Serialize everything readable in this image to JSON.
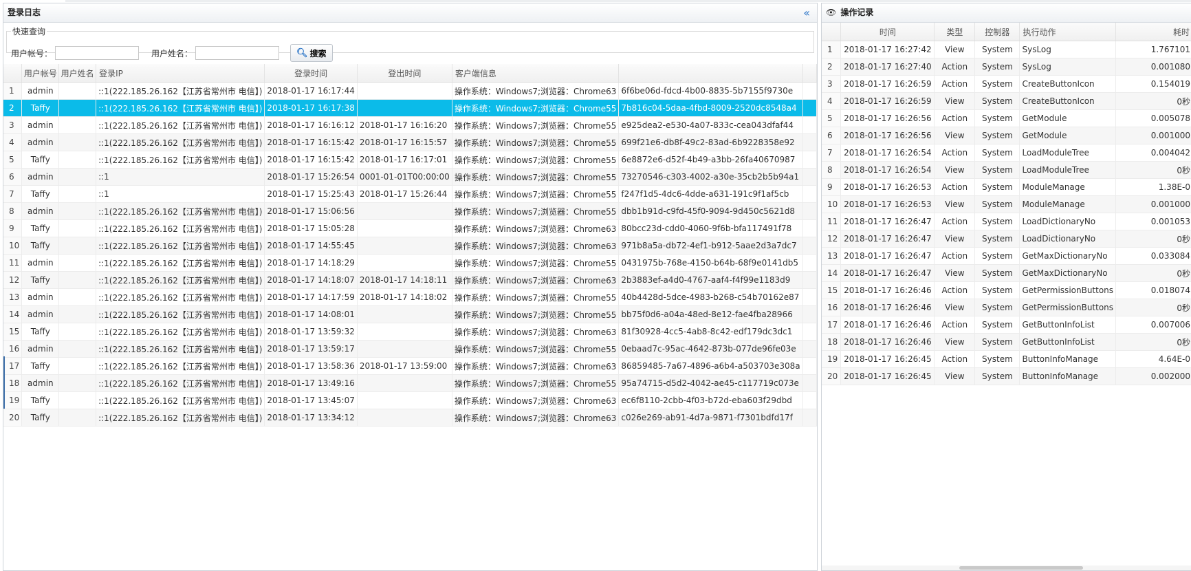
{
  "login_log": {
    "title": "登录日志",
    "collapse_icon": "«",
    "quick_search": {
      "legend": "快速查询",
      "account_label": "用户帐号：",
      "account_value": "",
      "name_label": "用户姓名：",
      "name_value": "",
      "search_button": "搜索"
    },
    "columns": [
      "用户帐号",
      "用户姓名",
      "登录IP",
      "登录时间",
      "登出时间",
      "客户端信息",
      ""
    ],
    "rows": [
      {
        "no": "1",
        "account": "admin",
        "name": "",
        "ip": "::1(222.185.26.162【江苏省常州市 电信】)",
        "login": "2018-01-17 16:17:44",
        "logout": "",
        "client": "操作系统：Windows7;浏览器：Chrome63",
        "session": "6f6be06d-fdcd-4b00-8835-5b7155f9730e"
      },
      {
        "no": "2",
        "account": "Taffy",
        "name": "",
        "ip": "::1(222.185.26.162【江苏省常州市 电信】)",
        "login": "2018-01-17 16:17:38",
        "logout": "",
        "client": "操作系统：Windows7;浏览器：Chrome55",
        "session": "7b816c04-5daa-4fbd-8009-2520dc8548a4"
      },
      {
        "no": "3",
        "account": "admin",
        "name": "",
        "ip": "::1(222.185.26.162【江苏省常州市 电信】)",
        "login": "2018-01-17 16:16:12",
        "logout": "2018-01-17 16:16:20",
        "client": "操作系统：Windows7;浏览器：Chrome55",
        "session": "e925dea2-e530-4a07-833c-cea043dfaf44"
      },
      {
        "no": "4",
        "account": "admin",
        "name": "",
        "ip": "::1(222.185.26.162【江苏省常州市 电信】)",
        "login": "2018-01-17 16:15:42",
        "logout": "2018-01-17 16:15:57",
        "client": "操作系统：Windows7;浏览器：Chrome55",
        "session": "699f21e6-db8f-49c2-83ad-6b9228358e92"
      },
      {
        "no": "5",
        "account": "Taffy",
        "name": "",
        "ip": "::1(222.185.26.162【江苏省常州市 电信】)",
        "login": "2018-01-17 16:15:42",
        "logout": "2018-01-17 16:17:01",
        "client": "操作系统：Windows7;浏览器：Chrome55",
        "session": "6e8872e6-d52f-4b49-a3bb-26fa40670987"
      },
      {
        "no": "6",
        "account": "admin",
        "name": "",
        "ip": "::1",
        "login": "2018-01-17 15:26:54",
        "logout": "0001-01-01T00:00:00",
        "client": "操作系统：Windows7;浏览器：Chrome55",
        "session": "73270546-c303-4002-a30e-35cb2b5b94a1"
      },
      {
        "no": "7",
        "account": "Taffy",
        "name": "",
        "ip": "::1",
        "login": "2018-01-17 15:25:43",
        "logout": "2018-01-17 15:26:44",
        "client": "操作系统：Windows7;浏览器：Chrome55",
        "session": "f247f1d5-4dc6-4dde-a631-191c9f1af5cb"
      },
      {
        "no": "8",
        "account": "admin",
        "name": "",
        "ip": "::1(222.185.26.162【江苏省常州市 电信】)",
        "login": "2018-01-17 15:06:56",
        "logout": "",
        "client": "操作系统：Windows7;浏览器：Chrome55",
        "session": "dbb1b91d-c9fd-45f0-9094-9d450c5621d8"
      },
      {
        "no": "9",
        "account": "Taffy",
        "name": "",
        "ip": "::1(222.185.26.162【江苏省常州市 电信】)",
        "login": "2018-01-17 15:05:28",
        "logout": "",
        "client": "操作系统：Windows7;浏览器：Chrome63",
        "session": "80bcc23d-cdd0-4060-9f6b-bfa117491f78"
      },
      {
        "no": "10",
        "account": "Taffy",
        "name": "",
        "ip": "::1(222.185.26.162【江苏省常州市 电信】)",
        "login": "2018-01-17 14:55:45",
        "logout": "",
        "client": "操作系统：Windows7;浏览器：Chrome63",
        "session": "971b8a5a-db72-4ef1-b912-5aae2d3a7dc7"
      },
      {
        "no": "11",
        "account": "admin",
        "name": "",
        "ip": "::1(222.185.26.162【江苏省常州市 电信】)",
        "login": "2018-01-17 14:18:29",
        "logout": "",
        "client": "操作系统：Windows7;浏览器：Chrome55",
        "session": "0431975b-768e-4150-b64b-68f9e0141db5"
      },
      {
        "no": "12",
        "account": "Taffy",
        "name": "",
        "ip": "::1(222.185.26.162【江苏省常州市 电信】)",
        "login": "2018-01-17 14:18:07",
        "logout": "2018-01-17 14:18:11",
        "client": "操作系统：Windows7;浏览器：Chrome63",
        "session": "2b3883ef-a4d0-4767-aaf4-f4f99e1183d9"
      },
      {
        "no": "13",
        "account": "admin",
        "name": "",
        "ip": "::1(222.185.26.162【江苏省常州市 电信】)",
        "login": "2018-01-17 14:17:59",
        "logout": "2018-01-17 14:18:02",
        "client": "操作系统：Windows7;浏览器：Chrome55",
        "session": "40b4428d-5dce-4983-b268-c54b70162e87"
      },
      {
        "no": "14",
        "account": "admin",
        "name": "",
        "ip": "::1(222.185.26.162【江苏省常州市 电信】)",
        "login": "2018-01-17 14:08:01",
        "logout": "",
        "client": "操作系统：Windows7;浏览器：Chrome55",
        "session": "bb75f0d6-a04a-48ed-8e12-fae4fba28966"
      },
      {
        "no": "15",
        "account": "Taffy",
        "name": "",
        "ip": "::1(222.185.26.162【江苏省常州市 电信】)",
        "login": "2018-01-17 13:59:32",
        "logout": "",
        "client": "操作系统：Windows7;浏览器：Chrome63",
        "session": "81f30928-4cc5-4ab8-8c42-edf179dc3dc1"
      },
      {
        "no": "16",
        "account": "admin",
        "name": "",
        "ip": "::1(222.185.26.162【江苏省常州市 电信】)",
        "login": "2018-01-17 13:59:17",
        "logout": "",
        "client": "操作系统：Windows7;浏览器：Chrome55",
        "session": "0ebaad7c-95ac-4642-873b-077de96fe03e"
      },
      {
        "no": "17",
        "account": "Taffy",
        "name": "",
        "ip": "::1(222.185.26.162【江苏省常州市 电信】)",
        "login": "2018-01-17 13:58:36",
        "logout": "2018-01-17 13:59:00",
        "client": "操作系统：Windows7;浏览器：Chrome63",
        "session": "86859485-7a67-4896-a6b4-a503703e308a"
      },
      {
        "no": "18",
        "account": "admin",
        "name": "",
        "ip": "::1(222.185.26.162【江苏省常州市 电信】)",
        "login": "2018-01-17 13:49:16",
        "logout": "",
        "client": "操作系统：Windows7;浏览器：Chrome55",
        "session": "95a74715-d5d2-4042-ae45-c117719c073e"
      },
      {
        "no": "19",
        "account": "Taffy",
        "name": "",
        "ip": "::1(222.185.26.162【江苏省常州市 电信】)",
        "login": "2018-01-17 13:45:07",
        "logout": "",
        "client": "操作系统：Windows7;浏览器：Chrome63",
        "session": "ec6f8110-2cbb-4f03-b72d-eba603f29dbd"
      },
      {
        "no": "20",
        "account": "Taffy",
        "name": "",
        "ip": "::1(222.185.26.162【江苏省常州市 电信】)",
        "login": "2018-01-17 13:34:12",
        "logout": "",
        "client": "操作系统：Windows7;浏览器：Chrome63",
        "session": "c026e269-ab91-4d7a-9871-f7301bdfd17f"
      }
    ],
    "selected_row": "2"
  },
  "operation_log": {
    "title": "操作记录",
    "icon": "eye-icon",
    "columns": [
      "时间",
      "类型",
      "控制器",
      "执行动作",
      "耗时"
    ],
    "rows": [
      {
        "no": "1",
        "time": "2018-01-17 16:27:42",
        "type": "View",
        "controller": "System",
        "action": "SysLog",
        "cost": "1.767101"
      },
      {
        "no": "2",
        "time": "2018-01-17 16:27:40",
        "type": "Action",
        "controller": "System",
        "action": "SysLog",
        "cost": "0.001080"
      },
      {
        "no": "3",
        "time": "2018-01-17 16:26:59",
        "type": "Action",
        "controller": "System",
        "action": "CreateButtonIcon",
        "cost": "0.154019"
      },
      {
        "no": "4",
        "time": "2018-01-17 16:26:59",
        "type": "View",
        "controller": "System",
        "action": "CreateButtonIcon",
        "cost": "0秒"
      },
      {
        "no": "5",
        "time": "2018-01-17 16:26:56",
        "type": "Action",
        "controller": "System",
        "action": "GetModule",
        "cost": "0.005078"
      },
      {
        "no": "6",
        "time": "2018-01-17 16:26:56",
        "type": "View",
        "controller": "System",
        "action": "GetModule",
        "cost": "0.001000"
      },
      {
        "no": "7",
        "time": "2018-01-17 16:26:54",
        "type": "Action",
        "controller": "System",
        "action": "LoadModuleTree",
        "cost": "0.004042"
      },
      {
        "no": "8",
        "time": "2018-01-17 16:26:54",
        "type": "View",
        "controller": "System",
        "action": "LoadModuleTree",
        "cost": "0秒"
      },
      {
        "no": "9",
        "time": "2018-01-17 16:26:53",
        "type": "Action",
        "controller": "System",
        "action": "ModuleManage",
        "cost": "1.38E-0"
      },
      {
        "no": "10",
        "time": "2018-01-17 16:26:53",
        "type": "View",
        "controller": "System",
        "action": "ModuleManage",
        "cost": "0.001000"
      },
      {
        "no": "11",
        "time": "2018-01-17 16:26:47",
        "type": "Action",
        "controller": "System",
        "action": "LoadDictionaryNo",
        "cost": "0.001053"
      },
      {
        "no": "12",
        "time": "2018-01-17 16:26:47",
        "type": "View",
        "controller": "System",
        "action": "LoadDictionaryNo",
        "cost": "0秒"
      },
      {
        "no": "13",
        "time": "2018-01-17 16:26:47",
        "type": "Action",
        "controller": "System",
        "action": "GetMaxDictionaryNo",
        "cost": "0.033084"
      },
      {
        "no": "14",
        "time": "2018-01-17 16:26:47",
        "type": "View",
        "controller": "System",
        "action": "GetMaxDictionaryNo",
        "cost": "0秒"
      },
      {
        "no": "15",
        "time": "2018-01-17 16:26:46",
        "type": "Action",
        "controller": "System",
        "action": "GetPermissionButtons",
        "cost": "0.018074"
      },
      {
        "no": "16",
        "time": "2018-01-17 16:26:46",
        "type": "View",
        "controller": "System",
        "action": "GetPermissionButtons",
        "cost": "0秒"
      },
      {
        "no": "17",
        "time": "2018-01-17 16:26:46",
        "type": "Action",
        "controller": "System",
        "action": "GetButtonInfoList",
        "cost": "0.007006"
      },
      {
        "no": "18",
        "time": "2018-01-17 16:26:46",
        "type": "View",
        "controller": "System",
        "action": "GetButtonInfoList",
        "cost": "0秒"
      },
      {
        "no": "19",
        "time": "2018-01-17 16:26:45",
        "type": "Action",
        "controller": "System",
        "action": "ButtonInfoManage",
        "cost": "4.64E-0"
      },
      {
        "no": "20",
        "time": "2018-01-17 16:26:45",
        "type": "View",
        "controller": "System",
        "action": "ButtonInfoManage",
        "cost": "0.002000"
      }
    ]
  },
  "colors": {
    "selected_row": "#0bbbe9",
    "accent": "#2a74c7"
  }
}
